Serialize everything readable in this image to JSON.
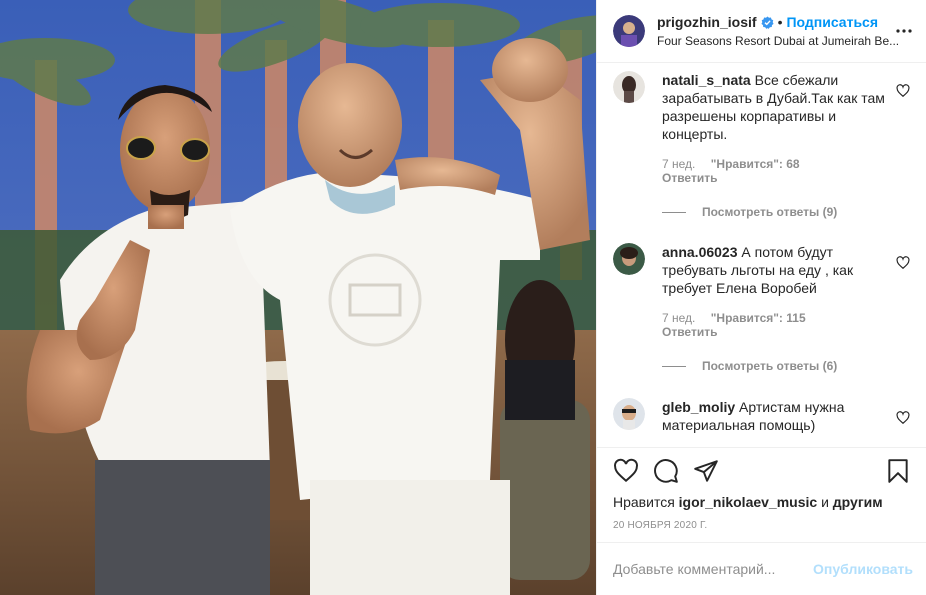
{
  "post": {
    "photo_label": "photo",
    "author": {
      "username": "prigozhin_iosif",
      "verified_icon": "verified-badge-icon",
      "follow_label": "Подписаться",
      "separator": "•",
      "location": "Four Seasons Resort Dubai at Jumeirah Be..."
    },
    "comments": [
      {
        "username": "natali_s_nata",
        "text": "Все сбежали зарабатывать в Дубай.Так как там разрешены корпаративы и концерты.",
        "time": "7 нед.",
        "likes": "\"Нравится\": 68",
        "reply_label": "Ответить",
        "view_replies": "Посмотреть ответы (9)"
      },
      {
        "username": "anna.06023",
        "text": "А потом будут требувать льготы на еду , как требует Елена Воробей",
        "time": "7 нед.",
        "likes": "\"Нравится\": 115",
        "reply_label": "Ответить",
        "view_replies": "Посмотреть ответы (6)"
      },
      {
        "username": "gleb_moliy",
        "text": "Артистам нужна материальная помощь)"
      }
    ],
    "actions": {
      "like_icon": "heart-icon",
      "comment_icon": "comment-bubble-icon",
      "share_icon": "paper-plane-icon",
      "save_icon": "bookmark-icon"
    },
    "likes_line": {
      "prefix": "Нравится",
      "user": "igor_nikolaev_music",
      "conj": "и",
      "others": "другим"
    },
    "date": "20 ноября 2020 г.",
    "add_comment": {
      "placeholder": "Добавьте комментарий...",
      "publish_label": "Опубликовать"
    }
  },
  "colors": {
    "accent": "#0095f6",
    "publish_disabled": "#b2dffc",
    "secondary_text": "#8e8e8e",
    "border": "#efefef"
  }
}
